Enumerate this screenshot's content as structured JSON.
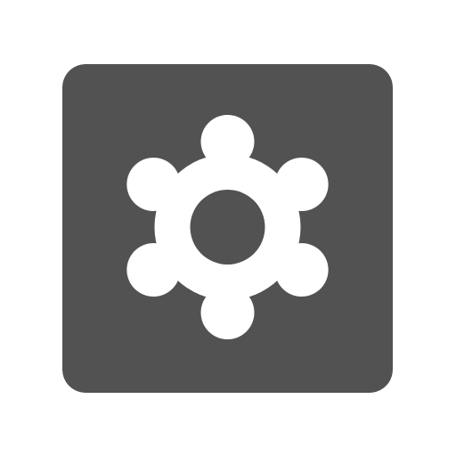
{
  "icon": {
    "name": "settings-gear-icon",
    "tile_color": "#525252",
    "glyph_color": "#ffffff"
  }
}
